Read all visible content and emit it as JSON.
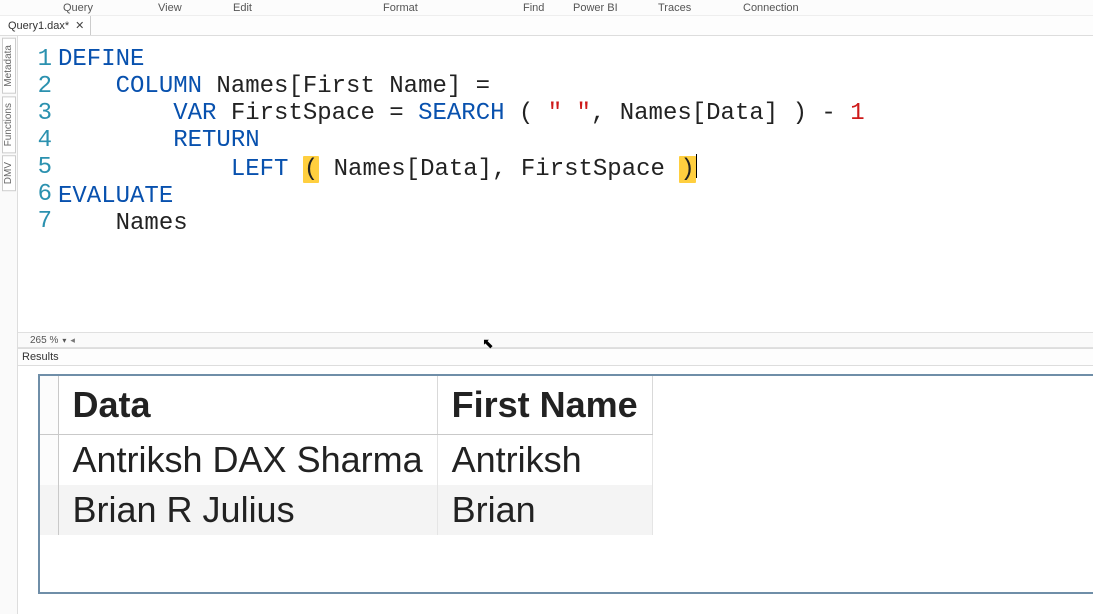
{
  "menu": {
    "items": [
      "Query",
      "View",
      "Edit",
      "Format",
      "Find",
      "Power BI",
      "Traces",
      "Connection"
    ],
    "positions": [
      55,
      150,
      225,
      375,
      515,
      575,
      650,
      745
    ]
  },
  "tab": {
    "label": "Query1.dax*",
    "close": "✕"
  },
  "sidetabs": [
    "Metadata",
    "Functions",
    "DMV"
  ],
  "editor": {
    "line_numbers": [
      "1",
      "2",
      "3",
      "4",
      "5",
      "6",
      "7"
    ],
    "lines": {
      "l1": {
        "kw": "DEFINE"
      },
      "l2": {
        "indent": "    ",
        "kw": "COLUMN",
        "rest": " Names[First Name] ="
      },
      "l3": {
        "indent": "        ",
        "kw": "VAR",
        "var": " FirstSpace = ",
        "fn": "SEARCH",
        "open": " ( ",
        "str": "\" \"",
        "mid": ", Names[Data] ) - ",
        "num": "1"
      },
      "l4": {
        "indent": "        ",
        "kw": "RETURN"
      },
      "l5": {
        "indent": "            ",
        "fn": "LEFT",
        "sp": " ",
        "openp": "(",
        "args": " Names[Data], FirstSpace ",
        "closep": ")"
      },
      "l6": {
        "kw": "EVALUATE"
      },
      "l7": {
        "indent": "    ",
        "txt": "Names"
      }
    }
  },
  "zoom": {
    "value": "265 %"
  },
  "results": {
    "label": "Results",
    "headers": [
      "Data",
      "First Name"
    ],
    "rows": [
      [
        "Antriksh DAX Sharma",
        "Antriksh"
      ],
      [
        "Brian R Julius",
        "Brian"
      ]
    ]
  }
}
